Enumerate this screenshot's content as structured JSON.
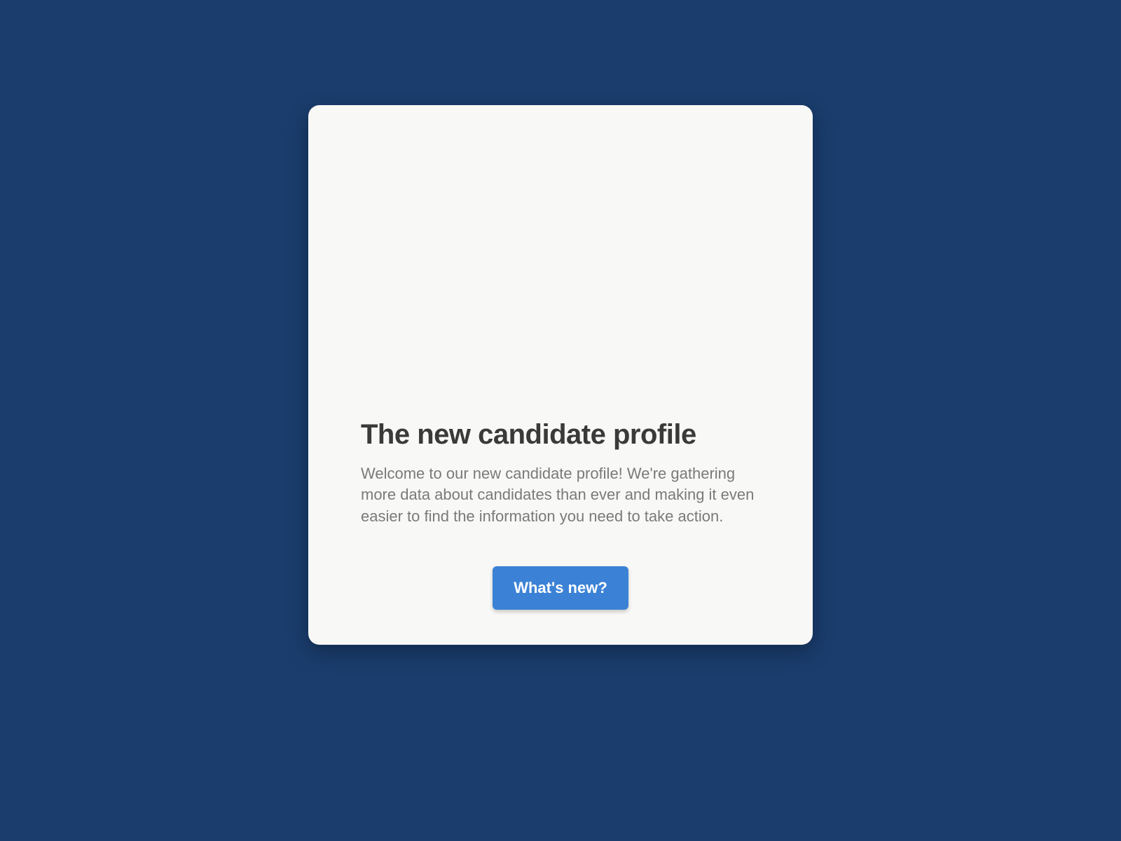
{
  "modal": {
    "title": "The new candidate profile",
    "description": "Welcome to our new candidate profile! We're gathering more data about candidates than ever and making  it even easier to find the information you need to take action.",
    "cta_label": "What's new?"
  },
  "colors": {
    "background": "#1a3d6d",
    "card": "#f8f8f6",
    "title_text": "#3a3a3a",
    "body_text": "#7a7a7a",
    "button": "#3b82d6",
    "button_text": "#ffffff"
  }
}
